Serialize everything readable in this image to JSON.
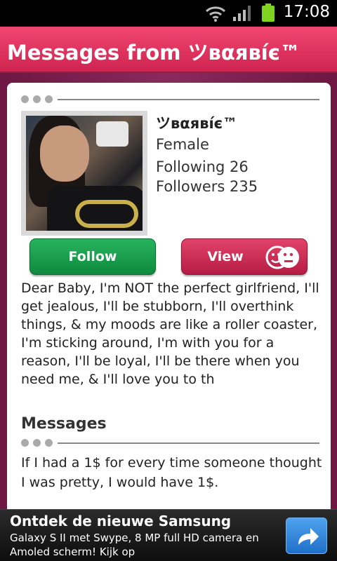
{
  "status_bar": {
    "time": "17:08",
    "icons": [
      "wifi-icon",
      "signal-icon",
      "battery-icon"
    ]
  },
  "header": {
    "title": "Messages from ツвαявíє™"
  },
  "profile": {
    "name": "ツвαявíє™",
    "gender": "Female",
    "following": "Following 26",
    "followers": "Followers 235",
    "avatar_icon": "profile-photo"
  },
  "actions": {
    "follow_label": "Follow",
    "view_label": "View",
    "view_icon": "faces-icon"
  },
  "bio": "Dear Baby, I'm NOT the perfect girlfriend, I'll get jealous, I'll be stubborn, I'll overthink things, & my moods are like a roller coaster, I'm sticking around, I'm with you for a reason, I'll be loyal, I'll be there when you need me, & I'll love you to th",
  "messages": {
    "title": "Messages",
    "items": [
      "If I had a 1$ for every time someone thought I was pretty, I would have 1$."
    ]
  },
  "ad": {
    "headline": "Ontdek de nieuwe Samsung",
    "body": "Galaxy S II met Swype, 8 MP full HD camera en Amoled scherm! Kijk op",
    "icon": "arrow-forward-icon"
  },
  "colors": {
    "title_bar": "#e23b63",
    "follow_button": "#1a9c4c",
    "view_button": "#cc2d55",
    "background": "#7a1f4c"
  }
}
